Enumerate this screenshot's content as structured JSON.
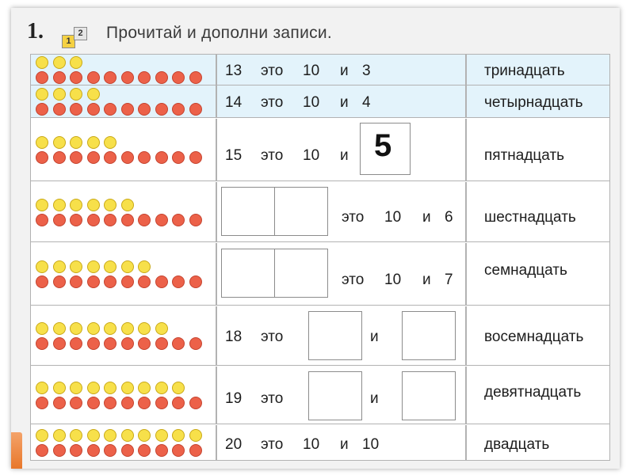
{
  "task": {
    "number": "1.",
    "level_badges": [
      "1",
      "2"
    ],
    "instruction": "Прочитай и дополни записи."
  },
  "colors": {
    "yellow_bead": "#f7e04a",
    "red_bead": "#ec6149",
    "highlight_row": "#e3f3fb"
  },
  "rows": [
    {
      "yellow": 3,
      "red": 10,
      "number": "13",
      "word1": "это",
      "ten": "10",
      "conj": "и",
      "units": "3",
      "name": "тринадцать"
    },
    {
      "yellow": 4,
      "red": 10,
      "number": "14",
      "word1": "это",
      "ten": "10",
      "conj": "и",
      "units": "4",
      "name": "четырнадцать"
    },
    {
      "yellow": 5,
      "red": 10,
      "number": "15",
      "word1": "это",
      "ten": "10",
      "conj": "и",
      "answer": "5",
      "name": "пятнадцать"
    },
    {
      "yellow": 6,
      "red": 10,
      "word1": "это",
      "ten": "10",
      "conj": "и",
      "units": "6",
      "name": "шестнадцать"
    },
    {
      "yellow": 7,
      "red": 10,
      "word1": "это",
      "ten": "10",
      "conj": "и",
      "units": "7",
      "name": "семнадцать"
    },
    {
      "yellow": 8,
      "red": 10,
      "number": "18",
      "word1": "это",
      "conj": "и",
      "name": "восемнадцать"
    },
    {
      "yellow": 9,
      "red": 10,
      "number": "19",
      "word1": "это",
      "conj": "и",
      "name": "девятнадцать"
    },
    {
      "yellow": 10,
      "red": 10,
      "number": "20",
      "word1": "это",
      "ten": "10",
      "conj": "и",
      "units": "10",
      "name": "двадцать"
    }
  ]
}
